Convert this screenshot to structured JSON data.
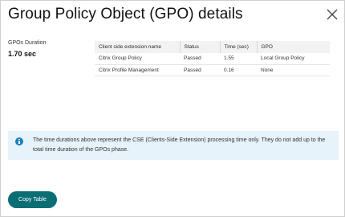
{
  "dialog": {
    "title": "Group Policy Object (GPO) details",
    "close_icon": "close-icon"
  },
  "summary": {
    "label": "GPOs Duration",
    "value": "1.70 sec"
  },
  "table": {
    "headers": [
      "Client side extension name",
      "Status",
      "Time (sec)",
      "GPO"
    ],
    "rows": [
      [
        "Citrix Group Policy",
        "Passed",
        "1.55",
        "Local Group Policy"
      ],
      [
        "Citrix Profile Management",
        "Passed",
        "0.16",
        "None"
      ]
    ]
  },
  "info": {
    "icon": "info-icon",
    "accent": "#1a7fbf",
    "background": "#e6f3fa",
    "text": "The time durations above represent the CSE (Clients-Side Extension) processing time only. They do not add up to the total time duration of the GPOs phase."
  },
  "actions": {
    "copy_label": "Copy Table",
    "copy_color": "#0b6e75"
  }
}
